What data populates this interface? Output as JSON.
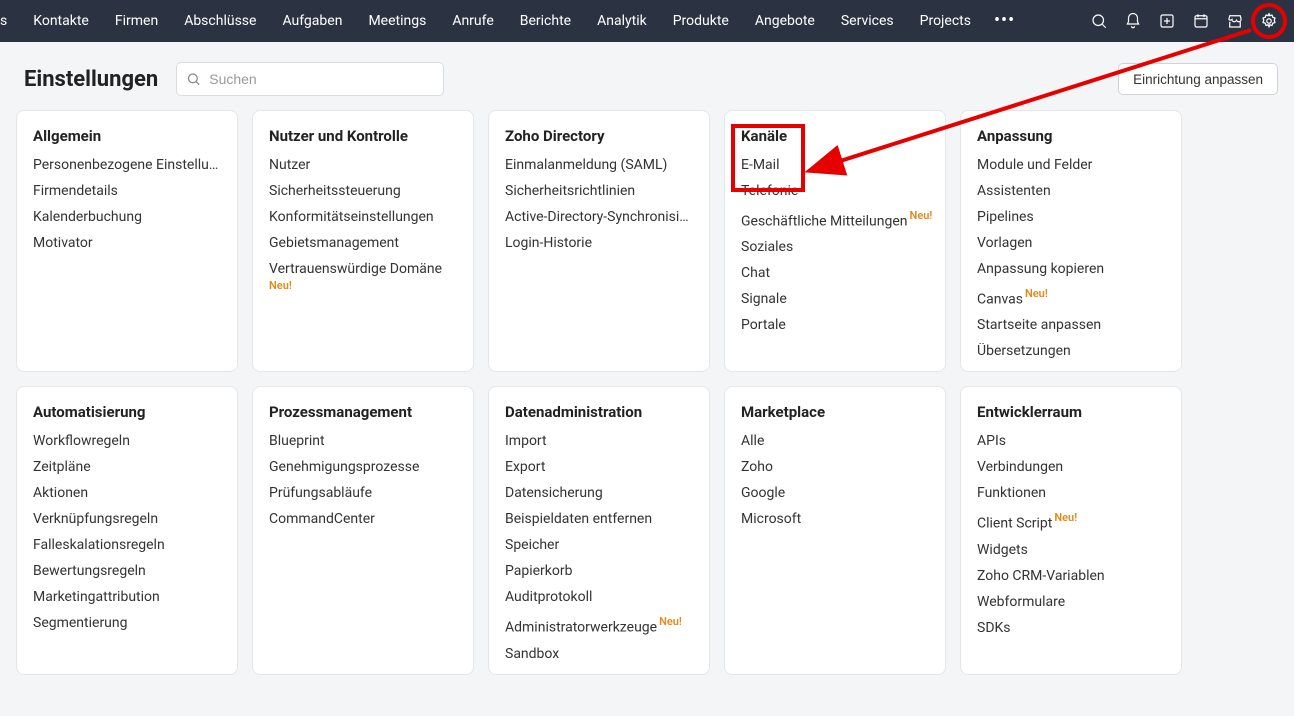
{
  "nav": {
    "items": [
      "s",
      "Kontakte",
      "Firmen",
      "Abschlüsse",
      "Aufgaben",
      "Meetings",
      "Anrufe",
      "Berichte",
      "Analytik",
      "Produkte",
      "Angebote",
      "Services",
      "Projects"
    ],
    "more": "•••"
  },
  "page": {
    "title": "Einstellungen",
    "search_placeholder": "Suchen",
    "customize_button": "Einrichtung anpassen"
  },
  "cards_row1": [
    {
      "title": "Allgemein",
      "items": [
        {
          "label": "Personenbezogene Einstellungen"
        },
        {
          "label": "Firmendetails"
        },
        {
          "label": "Kalenderbuchung"
        },
        {
          "label": "Motivator"
        }
      ]
    },
    {
      "title": "Nutzer und Kontrolle",
      "items": [
        {
          "label": "Nutzer"
        },
        {
          "label": "Sicherheitssteuerung"
        },
        {
          "label": "Konformitätseinstellungen"
        },
        {
          "label": "Gebietsmanagement"
        },
        {
          "label": "Vertrauenswürdige Domäne",
          "new_below": true
        }
      ]
    },
    {
      "title": "Zoho Directory",
      "items": [
        {
          "label": "Einmalanmeldung (SAML)"
        },
        {
          "label": "Sicherheitsrichtlinien"
        },
        {
          "label": "Active-Directory-Synchronisierung"
        },
        {
          "label": "Login-Historie"
        }
      ]
    },
    {
      "title": "Kanäle",
      "items": [
        {
          "label": "E-Mail"
        },
        {
          "label": "Telefonie"
        },
        {
          "label": "Geschäftliche Mitteilungen",
          "new": true
        },
        {
          "label": "Soziales"
        },
        {
          "label": "Chat"
        },
        {
          "label": "Signale"
        },
        {
          "label": "Portale"
        }
      ]
    },
    {
      "title": "Anpassung",
      "items": [
        {
          "label": "Module und Felder"
        },
        {
          "label": "Assistenten"
        },
        {
          "label": "Pipelines"
        },
        {
          "label": "Vorlagen"
        },
        {
          "label": "Anpassung kopieren"
        },
        {
          "label": "Canvas",
          "new": true
        },
        {
          "label": "Startseite anpassen"
        },
        {
          "label": "Übersetzungen"
        }
      ]
    }
  ],
  "cards_row2": [
    {
      "title": "Automatisierung",
      "items": [
        {
          "label": "Workflowregeln"
        },
        {
          "label": "Zeitpläne"
        },
        {
          "label": "Aktionen"
        },
        {
          "label": "Verknüpfungsregeln"
        },
        {
          "label": "Falleskalationsregeln"
        },
        {
          "label": "Bewertungsregeln"
        },
        {
          "label": "Marketingattribution"
        },
        {
          "label": "Segmentierung"
        }
      ]
    },
    {
      "title": "Prozessmanagement",
      "items": [
        {
          "label": "Blueprint"
        },
        {
          "label": "Genehmigungsprozesse"
        },
        {
          "label": "Prüfungsabläufe"
        },
        {
          "label": "CommandCenter"
        }
      ]
    },
    {
      "title": "Datenadministration",
      "items": [
        {
          "label": "Import"
        },
        {
          "label": "Export"
        },
        {
          "label": "Datensicherung"
        },
        {
          "label": "Beispieldaten entfernen"
        },
        {
          "label": "Speicher"
        },
        {
          "label": "Papierkorb"
        },
        {
          "label": "Auditprotokoll"
        },
        {
          "label": "Administratorwerkzeuge",
          "new": true
        },
        {
          "label": "Sandbox"
        }
      ]
    },
    {
      "title": "Marketplace",
      "items": [
        {
          "label": "Alle"
        },
        {
          "label": "Zoho"
        },
        {
          "label": "Google"
        },
        {
          "label": "Microsoft"
        }
      ]
    },
    {
      "title": "Entwicklerraum",
      "items": [
        {
          "label": "APIs"
        },
        {
          "label": "Verbindungen"
        },
        {
          "label": "Funktionen"
        },
        {
          "label": "Client Script",
          "new": true
        },
        {
          "label": "Widgets"
        },
        {
          "label": "Zoho CRM-Variablen"
        },
        {
          "label": "Webformulare"
        },
        {
          "label": "SDKs"
        }
      ]
    }
  ],
  "new_label": "Neu!"
}
